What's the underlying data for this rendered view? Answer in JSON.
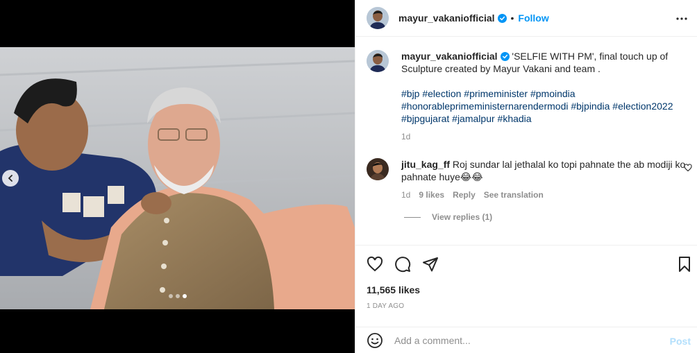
{
  "post": {
    "username": "mayur_vakaniofficial",
    "follow_label": "Follow",
    "separator": "•",
    "caption": "'SELFIE WITH PM', final touch up of Sculpture created by Mayur Vakani and team .",
    "hashtags": "#bjp #election #primeminister #pmoindia #honorableprimeministernarendermodi #bjpindia #election2022 #bjpgujarat #jamalpur #khadia",
    "caption_age": "1d",
    "likes": "11,565 likes",
    "posted_time": "1 DAY AGO",
    "carousel": {
      "total": 3,
      "active": 3
    },
    "icons": [
      "heart-icon",
      "comment-icon",
      "share-icon",
      "bookmark-icon",
      "more-icon",
      "verified-icon",
      "chevron-left-icon",
      "smile-icon"
    ]
  },
  "comment": {
    "username": "jitu_kag_ff",
    "text": "Roj sundar lal jethalal ko topi pahnate the ab modiji ko pahnate huye😂😂",
    "age": "1d",
    "likes": "9 likes",
    "reply_label": "Reply",
    "translate_label": "See translation",
    "view_replies": "View replies (1)"
  },
  "composer": {
    "placeholder": "Add a comment...",
    "post_label": "Post"
  },
  "colors": {
    "link": "#00376b",
    "follow": "#0095f6",
    "post_disabled": "#b2dffc",
    "muted": "#8e8e8e",
    "verified": "#0095f6"
  }
}
